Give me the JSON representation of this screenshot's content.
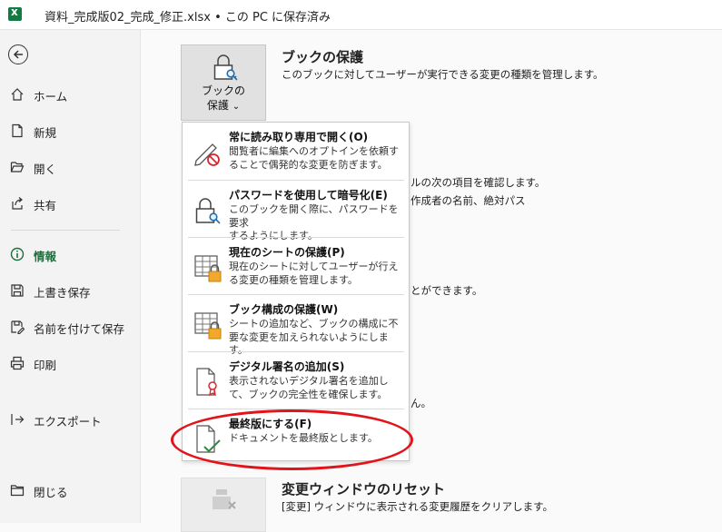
{
  "window": {
    "title": "資料_完成版02_完成_修正.xlsx • この PC に保存済み",
    "app_icon": "excel-icon"
  },
  "sidebar": {
    "back_icon": "back-arrow-icon",
    "items": [
      {
        "label": "ホーム",
        "icon": "home-icon"
      },
      {
        "label": "新規",
        "icon": "new-document-icon"
      },
      {
        "label": "開く",
        "icon": "folder-open-icon"
      },
      {
        "label": "共有",
        "icon": "share-icon"
      },
      {
        "label": "情報",
        "icon": "info-icon",
        "active": true
      },
      {
        "label": "上書き保存",
        "icon": "save-icon"
      },
      {
        "label": "名前を付けて保存",
        "icon": "save-as-icon"
      },
      {
        "label": "印刷",
        "icon": "print-icon"
      },
      {
        "label": "エクスポート",
        "icon": "export-icon"
      },
      {
        "label": "閉じる",
        "icon": "close-folder-icon"
      }
    ]
  },
  "main": {
    "protect": {
      "button_label_1": "ブックの",
      "button_label_2": "保護",
      "caret": "⌄",
      "title": "ブックの保護",
      "description": "このブックに対してユーザーが実行できる変更の種類を管理します。"
    },
    "obscured_texts": [
      "ルの次の項目を確認します。",
      "作成者の名前、絶対パス",
      "とができます。",
      "ん。"
    ],
    "reset": {
      "title": "変更ウィンドウのリセット",
      "description": "[変更] ウィンドウに表示される変更履歴をクリアします。"
    }
  },
  "protect_menu": {
    "items": [
      {
        "title": "常に読み取り専用で開く(O)",
        "desc_1": "閲覧者に編集へのオプトインを依頼す",
        "desc_2": "ることで偶発的な変更を防ぎます。",
        "icon": "pencil-no-icon"
      },
      {
        "title": "パスワードを使用して暗号化(E)",
        "desc_1": "このブックを開く際に、パスワードを要求",
        "desc_2": "するようにします。",
        "icon": "lock-key-icon"
      },
      {
        "title": "現在のシートの保護(P)",
        "desc_1": "現在のシートに対してユーザーが行え",
        "desc_2": "る変更の種類を管理します。",
        "icon": "sheet-lock-icon"
      },
      {
        "title": "ブック構成の保護(W)",
        "desc_1": "シートの追加など、ブックの構成に不",
        "desc_2": "要な変更を加えられないようにします。",
        "icon": "workbook-lock-icon"
      },
      {
        "title": "デジタル署名の追加(S)",
        "desc_1": "表示されないデジタル署名を追加し",
        "desc_2": "て、ブックの完全性を確保します。",
        "icon": "signature-ribbon-icon"
      },
      {
        "title": "最終版にする(F)",
        "desc_1": "ドキュメントを最終版とします。",
        "desc_2": "",
        "icon": "document-check-icon"
      }
    ]
  },
  "colors": {
    "accent_green": "#1e6e3c",
    "highlight_red": "#e0141a",
    "lock_orange": "#f0a830"
  }
}
